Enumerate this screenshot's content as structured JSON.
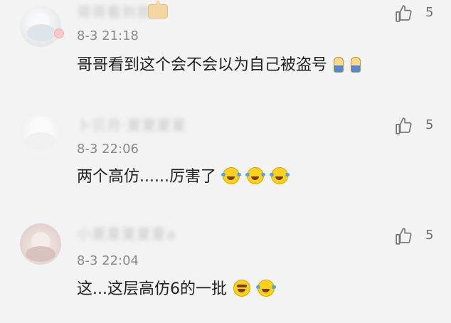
{
  "comments": [
    {
      "username": "哥哥看到我",
      "time": "8-3 21:18",
      "text": "哥哥看到这个会不会以为自己被盗号",
      "likes": "5"
    },
    {
      "username": "卜贝月·夏夏夏夏",
      "time": "8-3 22:06",
      "text": "两个高仿......厉害了",
      "likes": "5"
    },
    {
      "username": "小夏夏夏夏夏a",
      "time": "8-3 22:04",
      "text": "这...这层高仿6的一批",
      "likes": "5"
    }
  ],
  "colors": {
    "background": "#f3f3f3",
    "text": "#1f1f1f",
    "meta": "#8a8a8a",
    "like": "#6e6e6e"
  },
  "icons": {
    "like": "thumbs-up-icon",
    "avatar_badge": "badge-icon",
    "vip_badge": "crown-icon",
    "emoji": "emoji-icon"
  }
}
